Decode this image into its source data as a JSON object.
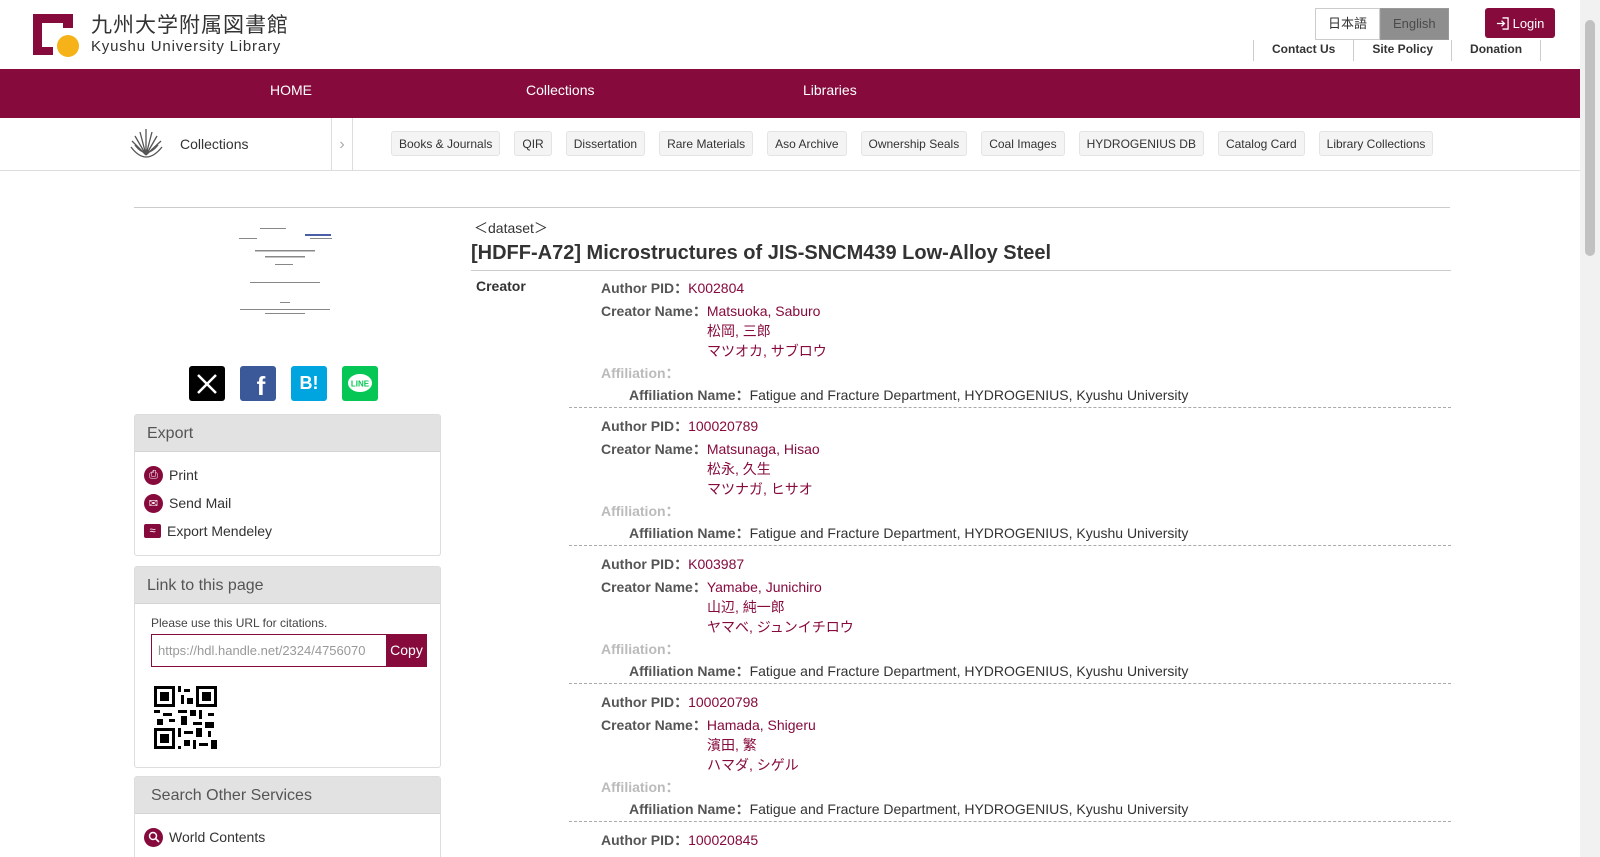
{
  "header": {
    "logo_jp": "九州大学附属図書館",
    "logo_en": "Kyushu University Library",
    "lang_ja": "日本語",
    "lang_en": "English",
    "login": "Login",
    "links": [
      "Contact Us",
      "Site Policy",
      "Donation"
    ]
  },
  "nav": {
    "items": [
      "HOME",
      "Collections",
      "Libraries"
    ]
  },
  "subnav": {
    "title": "Collections",
    "chips": [
      "Books & Journals",
      "QIR",
      "Dissertation",
      "Rare Materials",
      "Aso Archive",
      "Ownership Seals",
      "Coal Images",
      "HYDROGENIUS DB",
      "Catalog Card",
      "Library Collections"
    ]
  },
  "sidebar": {
    "export_title": "Export",
    "export_items": [
      "Print",
      "Send Mail",
      "Export Mendeley"
    ],
    "link_title": "Link to this page",
    "cite_label": "Please use this URL for citations.",
    "cite_url": "https://hdl.handle.net/2324/4756070",
    "copy": "Copy",
    "search_title": "Search Other Services",
    "search_items": [
      "World Contents"
    ]
  },
  "record": {
    "type": "＜dataset＞",
    "title": "[HDFF-A72] Microstructures of JIS-SNCM439 Low-Alloy Steel",
    "field": "Creator",
    "labels": {
      "pid": "Author PID：",
      "name": "Creator Name：",
      "aff": "Affiliation：",
      "affname": "Affiliation Name："
    },
    "creators": [
      {
        "pid": "K002804",
        "name": "Matsuoka, Saburo",
        "kanji": "松岡, 三郎",
        "kana": "マツオカ, サブロウ",
        "affiliation": "Fatigue and Fracture Department, HYDROGENIUS, Kyushu University"
      },
      {
        "pid": "100020789",
        "name": "Matsunaga, Hisao",
        "kanji": "松永, 久生",
        "kana": "マツナガ, ヒサオ",
        "affiliation": "Fatigue and Fracture Department, HYDROGENIUS, Kyushu University"
      },
      {
        "pid": "K003987",
        "name": "Yamabe, Junichiro",
        "kanji": "山辺, 純一郎",
        "kana": "ヤマベ, ジュンイチロウ",
        "affiliation": "Fatigue and Fracture Department, HYDROGENIUS, Kyushu University"
      },
      {
        "pid": "100020798",
        "name": "Hamada, Shigeru",
        "kanji": "濱田, 繁",
        "kana": "ハマダ, シゲル",
        "affiliation": "Fatigue and Fracture Department, HYDROGENIUS, Kyushu University"
      },
      {
        "pid": "100020845"
      }
    ]
  },
  "colors": {
    "brand": "#860a3c"
  }
}
